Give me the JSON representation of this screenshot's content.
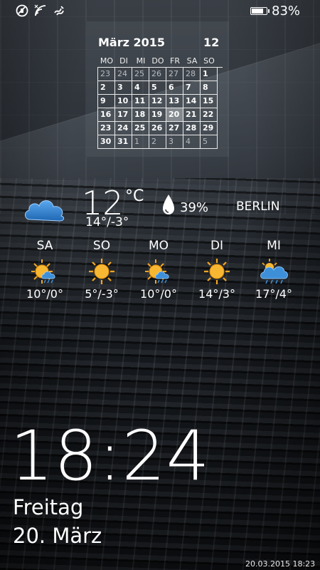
{
  "status_bar": {
    "icons": [
      "vibrate-icon",
      "signal-icon",
      "data-sync-icon"
    ],
    "battery_percent_label": "83%",
    "battery_level": 0.83
  },
  "calendar": {
    "month_year": "März 2015",
    "week_number": "12",
    "weekdays": [
      "MO",
      "DI",
      "MI",
      "DO",
      "FR",
      "SA",
      "SO"
    ],
    "weeks": [
      [
        {
          "d": "23",
          "out": true
        },
        {
          "d": "24",
          "out": true
        },
        {
          "d": "25",
          "out": true
        },
        {
          "d": "26",
          "out": true
        },
        {
          "d": "27",
          "out": true
        },
        {
          "d": "28",
          "out": true
        },
        {
          "d": "1"
        }
      ],
      [
        {
          "d": "2"
        },
        {
          "d": "3"
        },
        {
          "d": "4"
        },
        {
          "d": "5"
        },
        {
          "d": "6"
        },
        {
          "d": "7"
        },
        {
          "d": "8"
        }
      ],
      [
        {
          "d": "9"
        },
        {
          "d": "10"
        },
        {
          "d": "11"
        },
        {
          "d": "12"
        },
        {
          "d": "13"
        },
        {
          "d": "14"
        },
        {
          "d": "15"
        }
      ],
      [
        {
          "d": "16"
        },
        {
          "d": "17"
        },
        {
          "d": "18"
        },
        {
          "d": "19"
        },
        {
          "d": "20",
          "today": true
        },
        {
          "d": "21"
        },
        {
          "d": "22"
        }
      ],
      [
        {
          "d": "23"
        },
        {
          "d": "24"
        },
        {
          "d": "25"
        },
        {
          "d": "26"
        },
        {
          "d": "27"
        },
        {
          "d": "28"
        },
        {
          "d": "29"
        }
      ],
      [
        {
          "d": "30"
        },
        {
          "d": "31"
        },
        {
          "d": "1",
          "out": true
        },
        {
          "d": "2",
          "out": true
        },
        {
          "d": "3",
          "out": true
        },
        {
          "d": "4",
          "out": true
        },
        {
          "d": "5",
          "out": true
        }
      ]
    ]
  },
  "weather": {
    "icon": "cloudy-icon",
    "temperature": "12",
    "unit": "°C",
    "range": "14°/-3°",
    "humidity": "39%",
    "city": "BERLIN",
    "forecast": [
      {
        "day": "SA",
        "icon": "sun-cloud-rain-icon",
        "temps": "10°/0°"
      },
      {
        "day": "SO",
        "icon": "sun-icon",
        "temps": "5°/-3°"
      },
      {
        "day": "MO",
        "icon": "sun-cloud-rain-icon",
        "temps": "10°/0°"
      },
      {
        "day": "DI",
        "icon": "sun-icon",
        "temps": "14°/3°"
      },
      {
        "day": "MI",
        "icon": "cloud-rain-icon",
        "temps": "17°/4°"
      }
    ]
  },
  "lockscreen": {
    "time": "18:24",
    "weekday": "Freitag",
    "date": "20. März",
    "timestamp": "20.03.2015 18:23"
  },
  "colors": {
    "text": "#ffffff",
    "sun": "#f5a623",
    "cloud_blue": "#3d8fd8"
  }
}
